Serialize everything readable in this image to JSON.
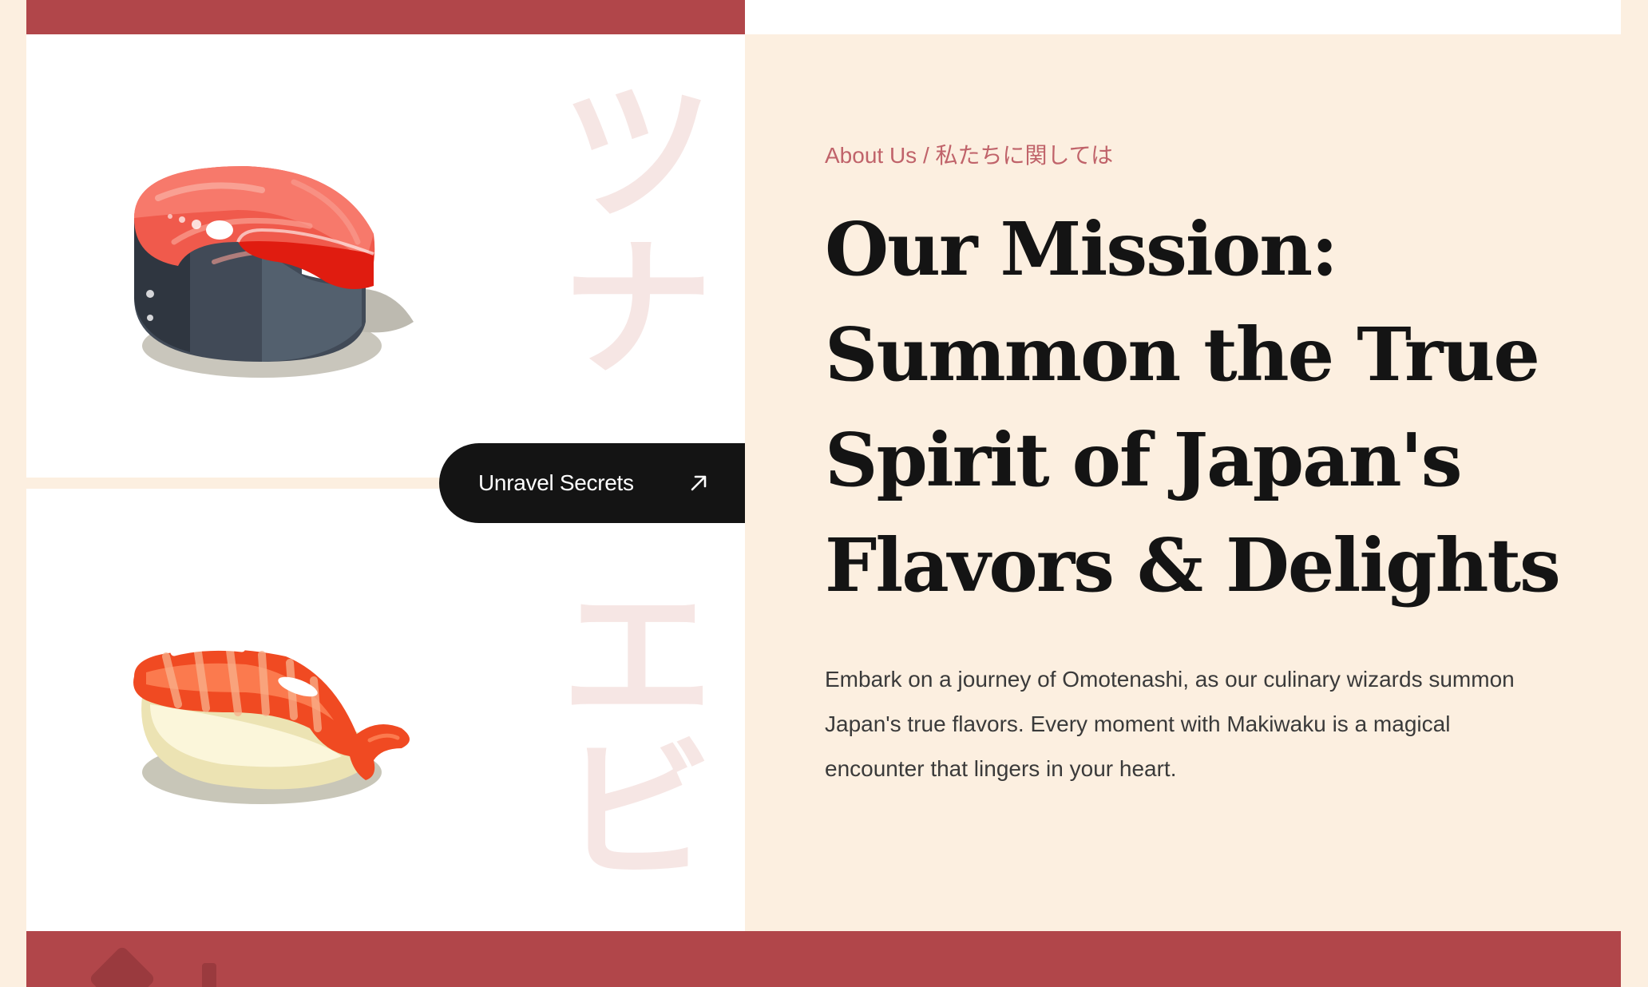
{
  "colors": {
    "background": "#fcefe0",
    "brand_red": "#b1464a",
    "eyebrow": "#c0636a",
    "headline": "#141414",
    "button_bg": "#141414",
    "kana_watermark": "#f6e6e4"
  },
  "kana": {
    "top_1": "ツ",
    "top_2": "ナ",
    "bottom_1": "エ",
    "bottom_2": "ビ"
  },
  "cta": {
    "label": "Unravel Secrets",
    "icon": "arrow-up-right-icon"
  },
  "about": {
    "eyebrow": "About Us / 私たちに関しては",
    "headline_lines": [
      "Our Mission:",
      "Summon the True",
      "Spirit of Japan's",
      "Flavors & Delights"
    ],
    "body_lines": [
      "Embark on a journey of Omotenashi, as our culinary wizards summon",
      "Japan's true flavors. Every moment with Makiwaku is a magical",
      "encounter that lingers in your heart."
    ]
  },
  "illustrations": {
    "top": "tuna-steak-illustration",
    "bottom": "ebi-nigiri-illustration"
  }
}
